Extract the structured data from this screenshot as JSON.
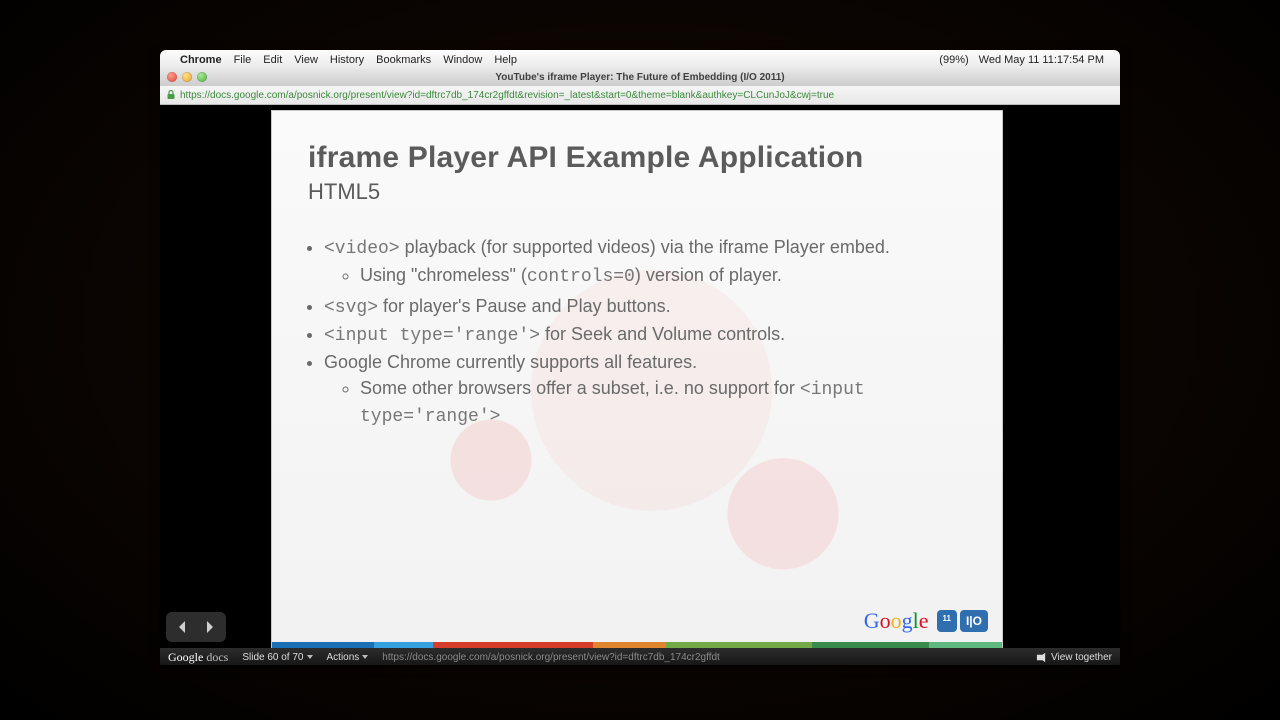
{
  "menubar": {
    "app": "Chrome",
    "items": [
      "File",
      "Edit",
      "View",
      "History",
      "Bookmarks",
      "Window",
      "Help"
    ],
    "battery": "(99%)",
    "clock": "Wed May 11  11:17:54 PM"
  },
  "window": {
    "title": "YouTube's iframe Player: The Future of Embedding (I/O 2011)"
  },
  "urlbar": {
    "url": "https://docs.google.com/a/posnick.org/present/view?id=dftrc7db_174cr2gffdt&revision=_latest&start=0&theme=blank&authkey=CLCunJoJ&cwj=true"
  },
  "slide": {
    "title": "iframe Player API Example Application",
    "subtitle": "HTML5",
    "b1_code": "<video>",
    "b1_rest": " playback (for supported videos) via the iframe Player embed.",
    "b1a_pre": "Using \"chromeless\" (",
    "b1a_code": "controls=0",
    "b1a_post": ") version of player.",
    "b2_code": "<svg>",
    "b2_rest": " for player's Pause and Play buttons.",
    "b3_code": "<input type='range'>",
    "b3_rest": " for Seek and Volume controls.",
    "b4": "Google Chrome currently supports all features.",
    "b4a_pre": "Some other browsers offer a subset, i.e. no support for ",
    "b4a_code": "<input type='range'>"
  },
  "brand": {
    "google": "Google",
    "io_year": "11",
    "io": "I|O"
  },
  "docsbar": {
    "logo_a": "Google",
    "logo_b": " docs",
    "slide_counter": "Slide 60 of 70",
    "actions": "Actions",
    "status_url": "https://docs.google.com/a/posnick.org/present/view?id=dftrc7db_174cr2gffdt",
    "view_together": "View together"
  }
}
